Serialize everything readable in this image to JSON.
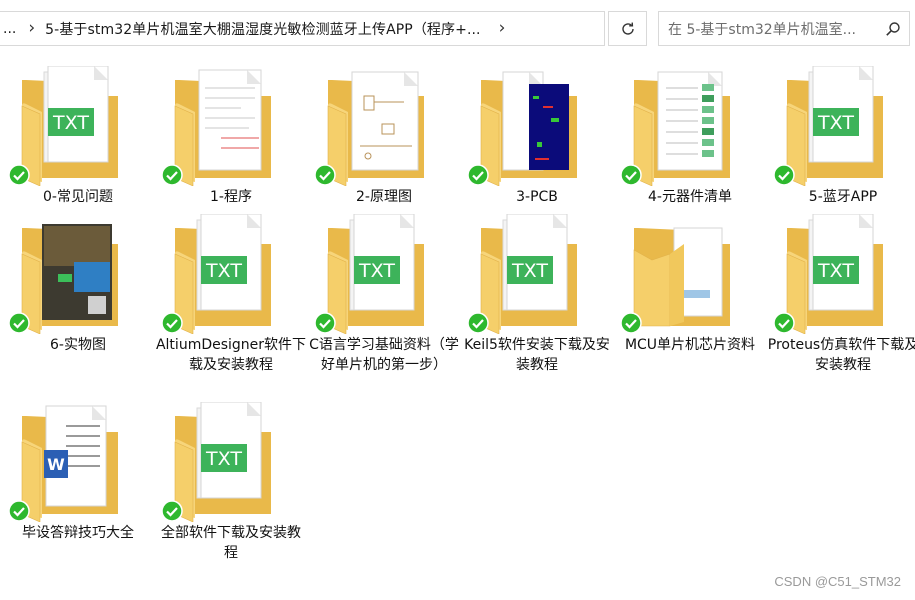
{
  "address_bar": {
    "overflow": "...",
    "path": "5-基于stm32单片机温室大棚温湿度光敏检测蓝牙上传APP（程序+...",
    "refresh_icon": "refresh-icon"
  },
  "search": {
    "placeholder": "在 5-基于stm32单片机温室..."
  },
  "items": [
    {
      "label": "0-常见问题",
      "type": "txt-folder"
    },
    {
      "label": "1-程序",
      "type": "doc-folder"
    },
    {
      "label": "2-原理图",
      "type": "schematic-folder"
    },
    {
      "label": "3-PCB",
      "type": "pcb-folder"
    },
    {
      "label": "4-元器件清单",
      "type": "list-folder"
    },
    {
      "label": "5-蓝牙APP",
      "type": "txt-folder"
    },
    {
      "label": "6-实物图",
      "type": "photo-folder"
    },
    {
      "label": "AltiumDesigner软件下载及安装教程",
      "type": "txt-folder"
    },
    {
      "label": "C语言学习基础资料（学好单片机的第一步）",
      "type": "txt-folder"
    },
    {
      "label": "Keil5软件安装下载及安装教程",
      "type": "txt-folder"
    },
    {
      "label": "MCU单片机芯片资料",
      "type": "plain-folder"
    },
    {
      "label": "Proteus仿真软件下载及安装教程",
      "type": "txt-folder"
    },
    {
      "label": "毕设答辩技巧大全",
      "type": "word-folder"
    },
    {
      "label": "全部软件下载及安装教程",
      "type": "txt-folder"
    }
  ],
  "icons": {
    "txt_badge": "TXT",
    "check_color": "#2eb82e",
    "folder_color": "#f5cf6a",
    "txt_green": "#3db35a"
  },
  "watermark": "CSDN @C51_STM32"
}
